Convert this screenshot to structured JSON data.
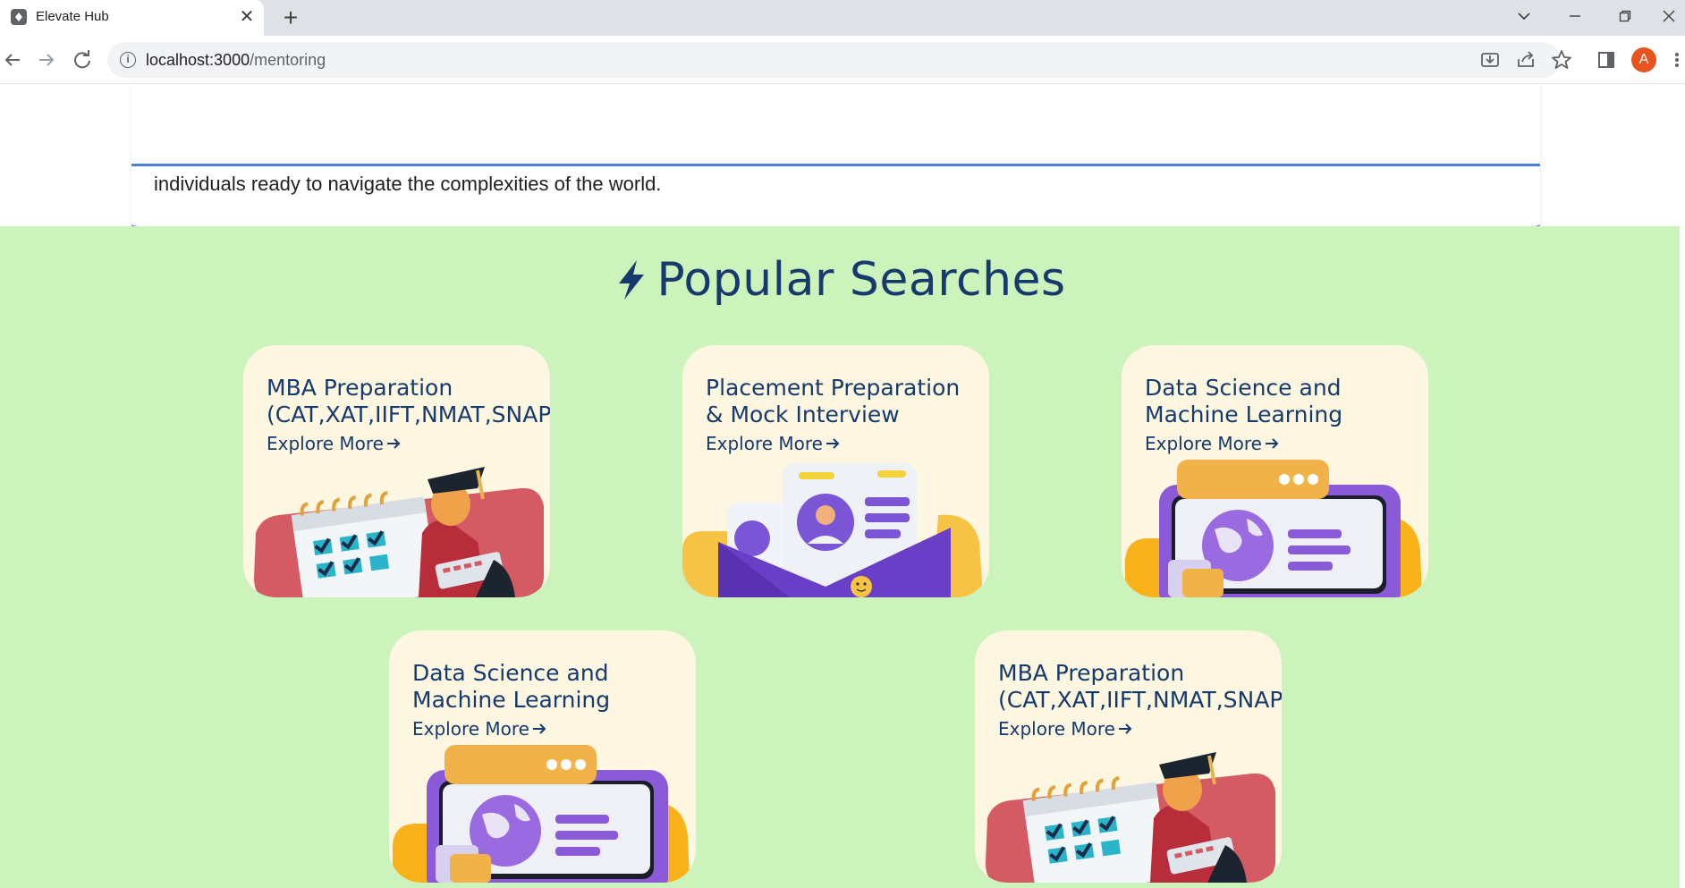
{
  "browser": {
    "tab_title": "Elevate Hub",
    "url_host": "localhost:3000",
    "url_path": "/mentoring",
    "profile_initial": "A"
  },
  "intro": {
    "text": "individuals ready to navigate the complexities of the world."
  },
  "popular": {
    "title": "Popular Searches",
    "cards": [
      {
        "title": "MBA Preparation (CAT,XAT,IIFT,NMAT,SNAP)",
        "link": "Explore More",
        "illustration": "calendar-graduate"
      },
      {
        "title": "Placement Preparation & Mock Interview",
        "link": "Explore More",
        "illustration": "profile-envelope"
      },
      {
        "title": "Data Science and Machine Learning",
        "link": "Explore More",
        "illustration": "globe-laptop"
      },
      {
        "title": "Data Science and Machine Learning",
        "link": "Explore More",
        "illustration": "globe-laptop"
      },
      {
        "title": "MBA Preparation (CAT,XAT,IIFT,NMAT,SNAP)",
        "link": "Explore More",
        "illustration": "calendar-graduate"
      }
    ]
  },
  "colors": {
    "section_bg": "#cdf3bd",
    "card_bg": "#fdf6e1",
    "heading": "#163a6b",
    "accent_line": "#4a80e0"
  }
}
